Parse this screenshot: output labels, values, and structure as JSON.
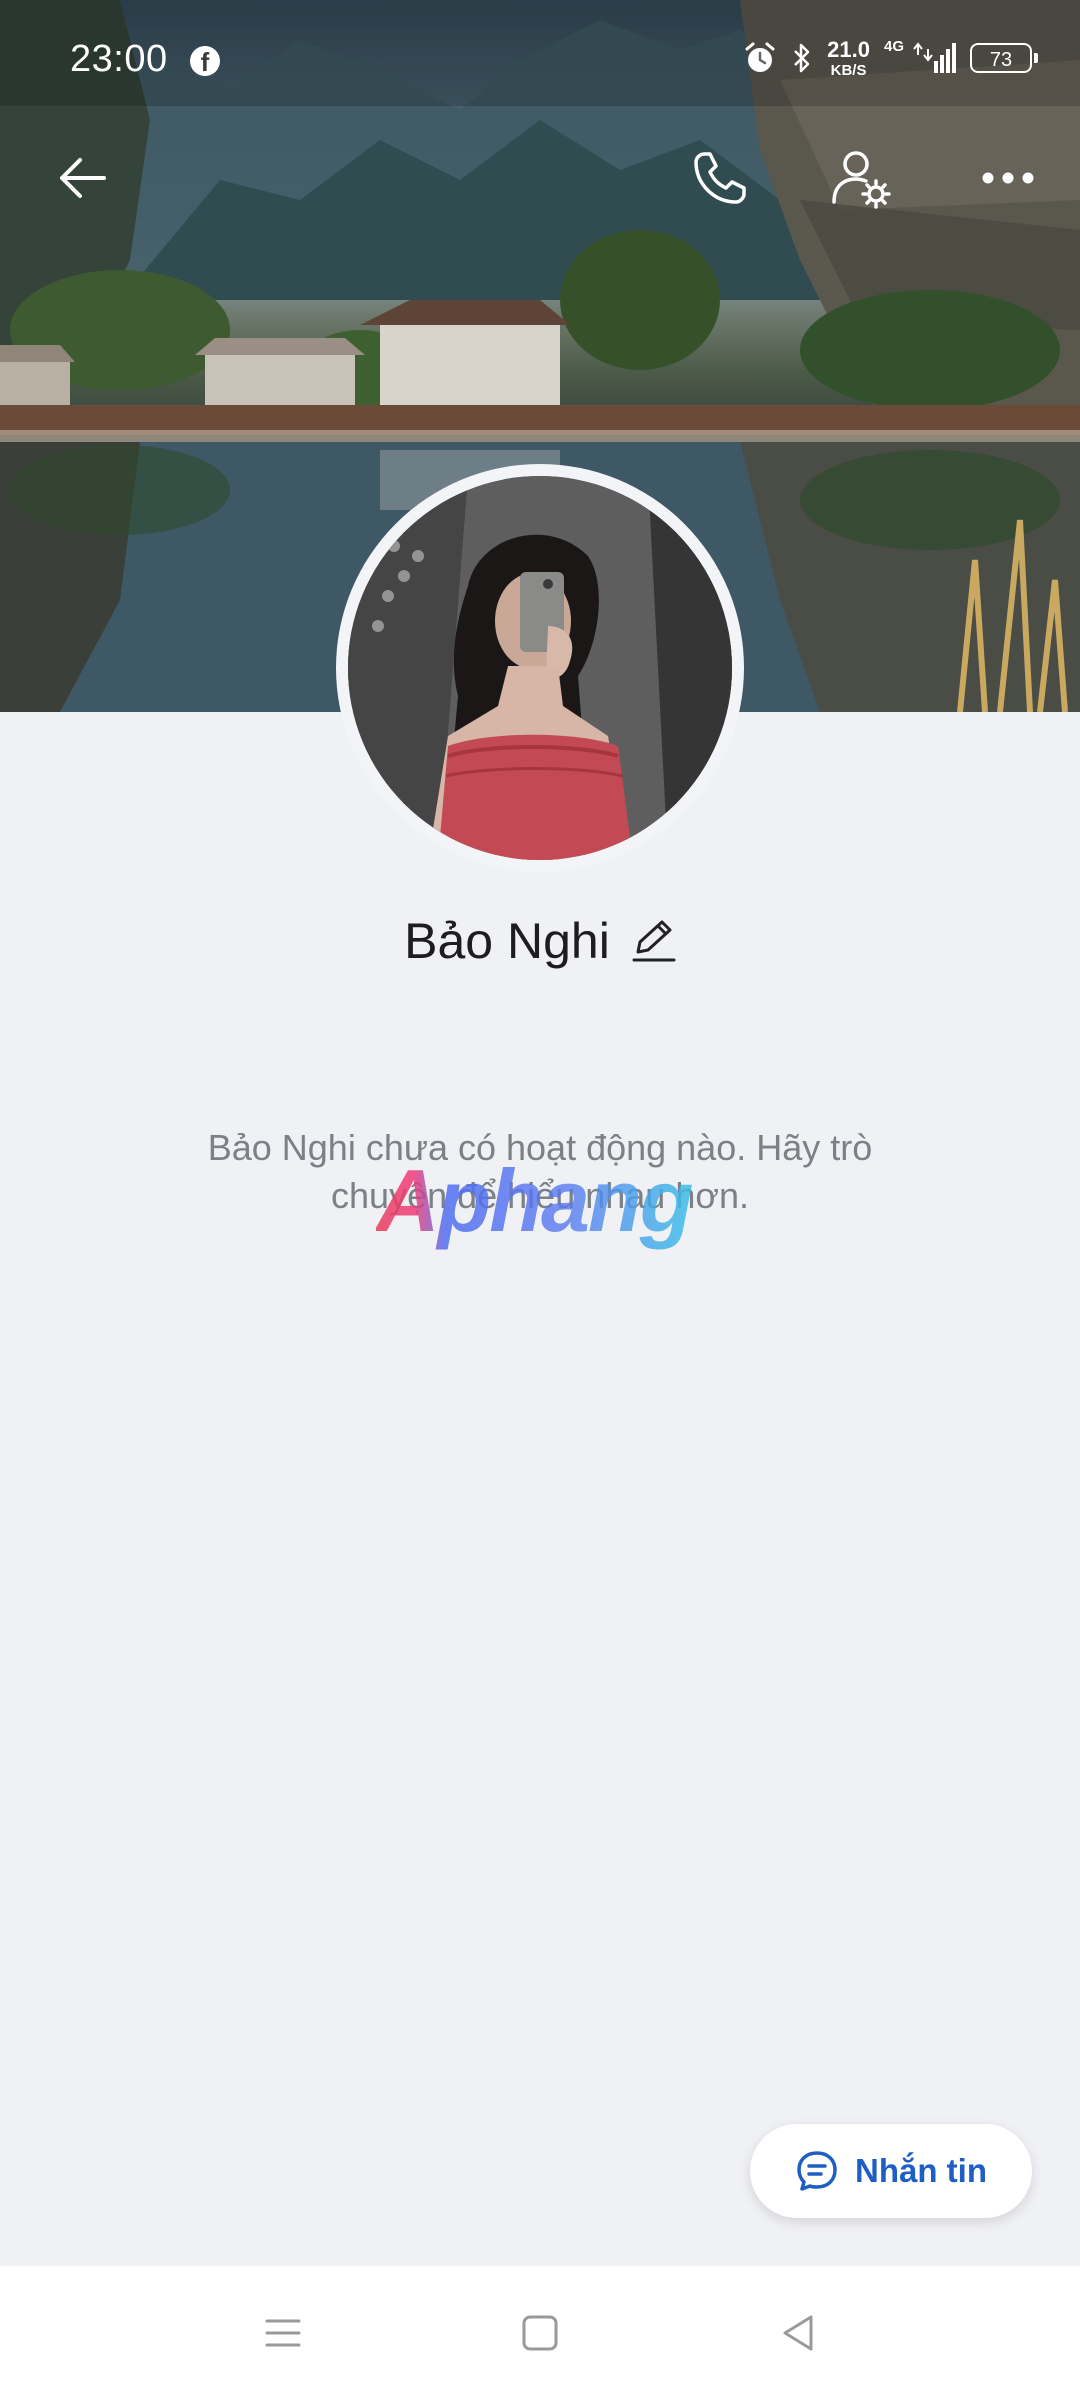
{
  "status_bar": {
    "time": "23:00",
    "app_notification_icon": "facebook-icon",
    "net_speed_value": "21.0",
    "net_speed_unit": "KB/S",
    "network_type": "4G",
    "battery_level": "73"
  },
  "header": {
    "back_icon": "arrow-left-icon",
    "call_icon": "phone-icon",
    "settings_icon": "user-settings-icon",
    "more_icon": "more-dots-icon"
  },
  "profile": {
    "name": "Bảo Nghi",
    "edit_icon": "pencil-icon",
    "empty_message": "Bảo Nghi chưa có hoạt động nào. Hãy trò chuyện để hiểu nhau hơn."
  },
  "watermark": "Aphang",
  "message_button": {
    "label": "Nhắn tin",
    "icon": "chat-bubble-icon",
    "color": "#1f5fc4"
  },
  "nav_bar": {
    "menu_icon": "menu-icon",
    "home_icon": "home-square-icon",
    "back_icon": "back-triangle-icon"
  }
}
